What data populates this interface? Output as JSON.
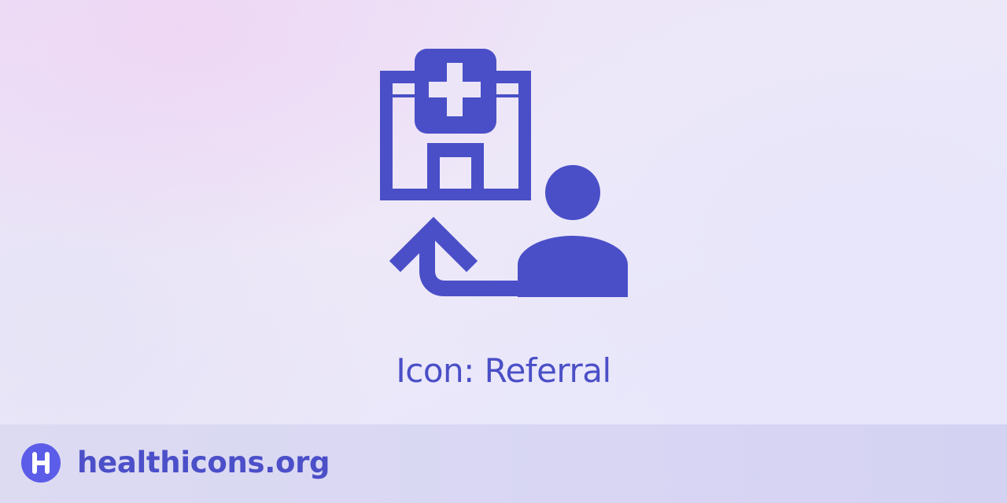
{
  "caption": "Icon: Referral",
  "icon": {
    "name": "referral-icon",
    "description_parts": [
      "hospital-icon",
      "up-arrow-icon",
      "person-icon"
    ],
    "color": "#4a4fc7"
  },
  "footer": {
    "logo_letter": "H",
    "site_name": "healthicons.org",
    "logo_color": "#5b5ce8"
  },
  "colors": {
    "accent": "#4a4fc7",
    "footer_bg": "#d9d8f2",
    "background": "#ece6f8"
  }
}
